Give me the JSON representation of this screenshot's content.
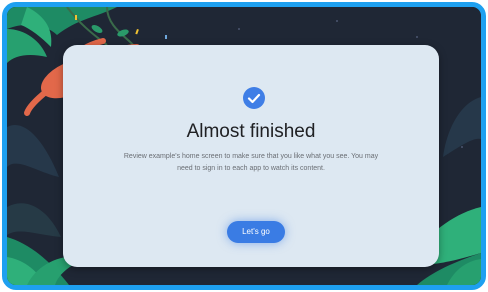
{
  "dialog": {
    "title": "Almost finished",
    "description": "Review example's home screen to make sure that you like what you see. You may need to sign in to each app to watch its content.",
    "button_label": "Let's go"
  },
  "icons": {
    "status": "check-circle-icon",
    "top_left_illustration": "sloth-hanging-from-vine-illustration",
    "bottom_right_illustration": "beetle-on-leaf-illustration"
  },
  "colors": {
    "frame_border": "#1ea0f0",
    "background": "#1f2735",
    "card": "#dde8f2",
    "accent": "#3a7ce4"
  }
}
